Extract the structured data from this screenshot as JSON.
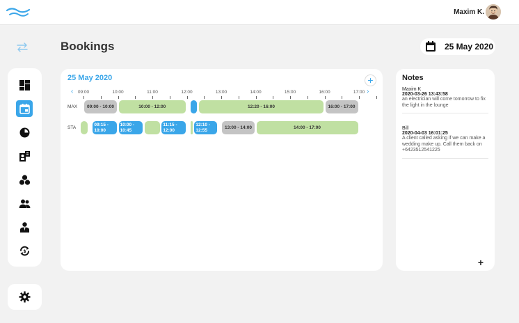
{
  "colors": {
    "accent": "#3aa6e9",
    "green": "#c0e0a2",
    "gray": "#c4c4c4",
    "background": "#f2f2f2"
  },
  "header": {
    "user_name": "Maxim K.",
    "logo_icon": "wave-logo-icon"
  },
  "page": {
    "title": "Bookings",
    "date": "25 May 2020"
  },
  "sidebar": {
    "items": [
      {
        "icon": "dashboard-icon",
        "active": false
      },
      {
        "icon": "calendar-icon",
        "active": true
      },
      {
        "icon": "reports-pie-icon",
        "active": false
      },
      {
        "icon": "customers-icon",
        "active": false
      },
      {
        "icon": "services-icon",
        "active": false
      },
      {
        "icon": "staff-icon",
        "active": false
      },
      {
        "icon": "employee-icon",
        "active": false
      },
      {
        "icon": "sync-icon",
        "active": false
      }
    ],
    "settings_icon": "gear-icon"
  },
  "calendar": {
    "title": "25 May 2020",
    "add_label": "+",
    "prev_label": "‹",
    "next_label": "›",
    "hours": [
      "09:00",
      "10:00",
      "11:00",
      "12:00",
      "13:00",
      "14:00",
      "15:00",
      "16:00",
      "17:00"
    ],
    "rows": [
      {
        "label": "MAX",
        "bookings": [
          {
            "start": 9.0,
            "end": 10.0,
            "kind": "gray",
            "text": "09:00 - 10:00"
          },
          {
            "start": 10.0,
            "end": 12.0,
            "kind": "green",
            "text": "10:00 - 12:00"
          },
          {
            "start": 12.083,
            "end": 12.333,
            "kind": "blue",
            "text": ""
          },
          {
            "start": 12.333,
            "end": 16.0,
            "kind": "green",
            "text": "12:20 - 16:00"
          },
          {
            "start": 16.0,
            "end": 17.0,
            "kind": "gray",
            "text": "16:00 - 17:00"
          }
        ]
      },
      {
        "label": "STA",
        "bookings": [
          {
            "start": 8.9,
            "end": 9.15,
            "kind": "green",
            "text": ""
          },
          {
            "start": 9.25,
            "end": 10.0,
            "kind": "blue",
            "text": "09:15 -\n10:00"
          },
          {
            "start": 10.0,
            "end": 10.75,
            "kind": "blue",
            "text": "10:00 -\n10:45"
          },
          {
            "start": 10.75,
            "end": 11.25,
            "kind": "green",
            "text": ""
          },
          {
            "start": 11.25,
            "end": 12.0,
            "kind": "blue",
            "text": "11:15 - 12:00"
          },
          {
            "start": 12.083,
            "end": 12.2,
            "kind": "green",
            "text": ""
          },
          {
            "start": 12.2,
            "end": 12.917,
            "kind": "blue",
            "text": "12:10 -\n12:55"
          },
          {
            "start": 13.0,
            "end": 14.0,
            "kind": "gray",
            "text": "13:00 - 14:00"
          },
          {
            "start": 14.0,
            "end": 17.0,
            "kind": "green",
            "text": "14:00 - 17:00"
          }
        ]
      }
    ]
  },
  "notes": {
    "title": "Notes",
    "add_label": "+",
    "items": [
      {
        "author": "Maxim K",
        "timestamp": "2020-03-26 13:43:58",
        "text": "an electrician will come tomorrow to fix the light in the lounge"
      },
      {
        "author": "Bill",
        "timestamp": "2020-04-03 16:01:25",
        "text": "A client called asking if we can make a wedding make up. Call them back on +6423512541225"
      }
    ]
  }
}
